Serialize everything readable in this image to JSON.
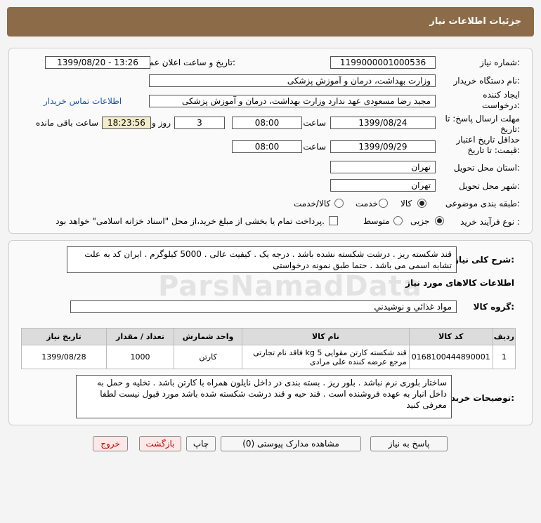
{
  "header": {
    "title": "جزئیات اطلاعات نیاز"
  },
  "info": {
    "need_number_label": "شماره نیاز:",
    "need_number": "1199000001000536",
    "announce_label": "تاریخ و ساعت اعلان عمومی:",
    "announce_value": "1399/08/20 - 13:26",
    "buyer_label": "نام دستگاه خریدار:",
    "buyer_value": "وزارت بهداشت، درمان و آموزش پزشکی",
    "creator_label": "ایجاد کننده درخواست:",
    "creator_value": "مجید رضا مسعودی عهد ندارد وزارت بهداشت، درمان و آموزش پزشکی",
    "contact_link": "اطلاعات تماس خریدار",
    "deadline_label": "مهلت ارسال پاسخ: تا تاریخ:",
    "deadline_date": "1399/08/24",
    "time_label": "ساعت",
    "deadline_time": "08:00",
    "days_value": "3",
    "days_label": "روز و",
    "remaining_time": "18:23:56",
    "remaining_label": "ساعت باقی مانده",
    "validity_label": "حداقل تاریخ اعتبار قیمت: تا تاریخ:",
    "validity_date": "1399/09/29",
    "validity_time_label": "ساعت",
    "validity_time": "08:00",
    "province_label": "استان محل تحویل:",
    "province_value": "تهران",
    "city_label": "شهر محل تحویل:",
    "city_value": "تهران",
    "category_label": "طبقه بندی موضوعی:",
    "category_options": [
      "کالا",
      "خدمت",
      "کالا/خدمت"
    ],
    "process_label": "نوع فرآیند خرید :",
    "process_options": [
      "جزیی",
      "متوسط"
    ],
    "payment_note": "پرداخت تمام یا بخشی از مبلغ خرید،از محل \"اسناد خزانه اسلامی\" خواهد بود."
  },
  "details": {
    "desc_label": "شرح کلی نیاز:",
    "desc_value": "قند شکسته ریز . درشت شکسته نشده باشد . درجه یک . کیفیت عالی .  5000 کیلوگرم . ایران کد به علت تشابه اسمی می باشد . حتما طبق نمونه درخواستی",
    "goods_info_title": "اطلاعات کالاهای مورد نیاز",
    "group_label": "گروه کالا:",
    "group_value": "مواد غذائي و نوشيدني",
    "table": {
      "headers": [
        "ردیف",
        "کد کالا",
        "نام کالا",
        "واحد شمارش",
        "تعداد / مقدار",
        "تاریخ نیاز"
      ],
      "rows": [
        [
          "1",
          "0168100444890001",
          "قند شکسته کارتن مقوایی 5 kg فاقد نام تجارتی مرجع عرضه کننده علی مرادی",
          "کارتن",
          "1000",
          "1399/08/28"
        ]
      ]
    },
    "buyer_notes_label": "توضیحات خریدار:",
    "buyer_notes": "ساختار بلوری نرم نباشد . بلور ریز . بسته بندی در داخل نایلون همراه با کارتن باشد . تخلیه و حمل به داخل انبار به عهده  فروشنده است . قند حبه و قند درشت شکسته شده باشد مورد قبول نیست لطفا معرفی کنید"
  },
  "buttons": {
    "respond": "پاسخ به نیاز",
    "attachments": "مشاهده مدارک پیوستی (0)",
    "print": "چاپ",
    "back": "بازگشت",
    "exit": "خروج"
  },
  "watermark": "ParsNamadData",
  "colors": {
    "header_bg": "#8c6b48",
    "highlight": "#f3eccb",
    "link": "#1a56b0"
  }
}
